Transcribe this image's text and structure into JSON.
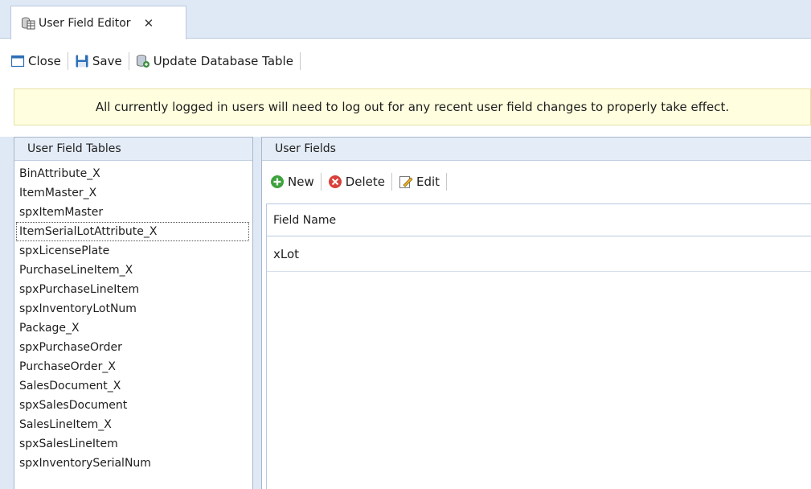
{
  "tab": {
    "label": "User Field Editor",
    "close_glyph": "✕",
    "icon": "database-table-icon"
  },
  "toolbar": {
    "close_label": "Close",
    "save_label": "Save",
    "update_label": "Update Database Table"
  },
  "notice": {
    "text": "All currently logged in users will need to log out for any recent user field changes to properly take effect."
  },
  "left_panel": {
    "title": "User Field Tables",
    "selected_index": 3,
    "items": [
      "BinAttribute_X",
      "ItemMaster_X",
      "spxItemMaster",
      "ItemSerialLotAttribute_X",
      "spxLicensePlate",
      "PurchaseLineItem_X",
      "spxPurchaseLineItem",
      "spxInventoryLotNum",
      "Package_X",
      "spxPurchaseOrder",
      "PurchaseOrder_X",
      "SalesDocument_X",
      "spxSalesDocument",
      "SalesLineItem_X",
      "spxSalesLineItem",
      "spxInventorySerialNum"
    ]
  },
  "right_panel": {
    "title": "User Fields",
    "new_label": "New",
    "delete_label": "Delete",
    "edit_label": "Edit",
    "grid": {
      "columns": [
        "Field Name"
      ],
      "rows": [
        [
          "xLot"
        ]
      ]
    }
  },
  "colors": {
    "chrome_blue": "#dfe8f5",
    "notice_bg": "#ffffdf",
    "panel_header": "#e4ecf7"
  }
}
